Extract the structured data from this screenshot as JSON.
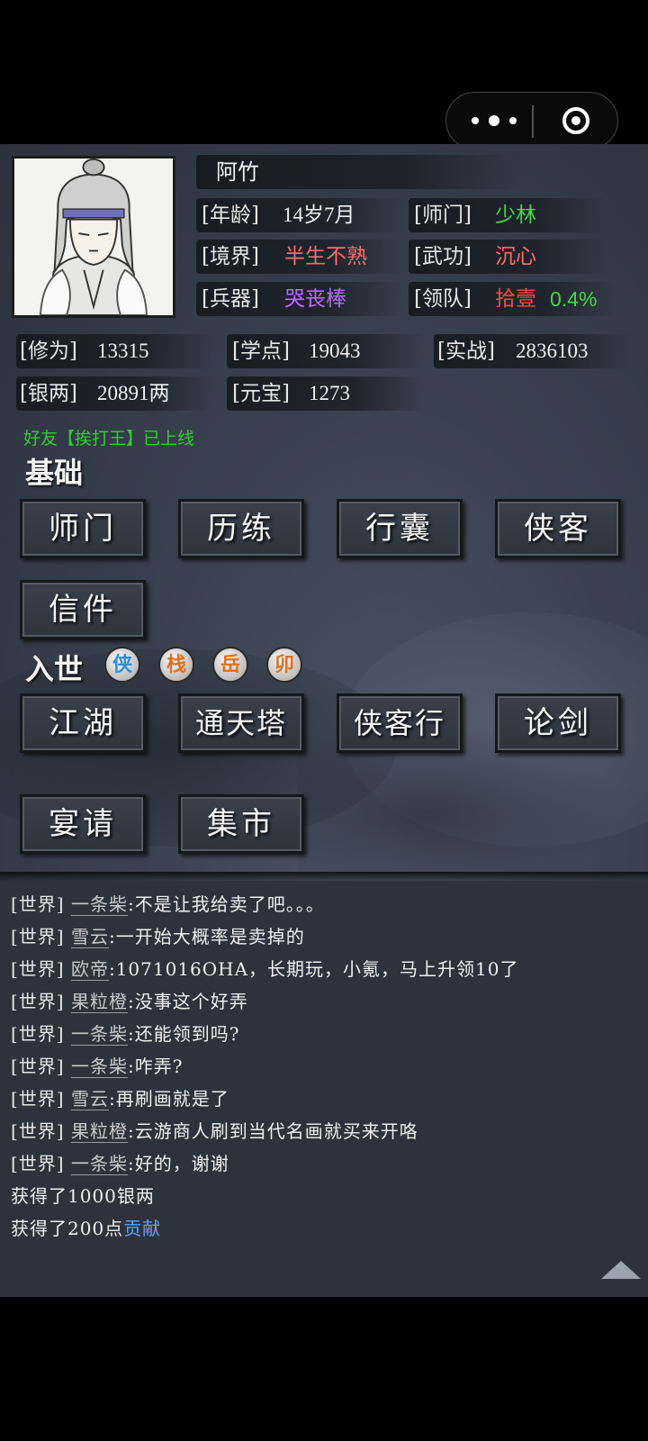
{
  "player": {
    "name": "阿竹",
    "age_label": "[年龄]",
    "age": "14岁7月",
    "sect_label": "[师门]",
    "sect": "少林",
    "realm_label": "[境界]",
    "realm": "半生不熟",
    "martial_label": "[武功]",
    "martial": "沉心",
    "weapon_label": "[兵器]",
    "weapon": "哭丧棒",
    "team_label": "[领队]",
    "team": "拾壹",
    "team_pct": "0.4%"
  },
  "stats": {
    "cultivation_label": "[修为]",
    "cultivation": "13315",
    "study_label": "[学点]",
    "study": "19043",
    "combat_label": "[实战]",
    "combat": "2836103",
    "silver_label": "[银两]",
    "silver": "20891两",
    "yuanbao_label": "[元宝]",
    "yuanbao": "1273"
  },
  "notice": "好友【挨打王】已上线",
  "basic": {
    "title": "基础",
    "buttons": [
      "师门",
      "历练",
      "行囊",
      "侠客",
      "信件"
    ]
  },
  "world": {
    "title": "入世",
    "badges": [
      {
        "label": "侠",
        "color": "#2f8fd8"
      },
      {
        "label": "栈",
        "color": "#e0701c"
      },
      {
        "label": "岳",
        "color": "#e0701c"
      },
      {
        "label": "卯",
        "color": "#e0701c"
      }
    ],
    "buttons": [
      "江湖",
      "通天塔",
      "侠客行",
      "论剑",
      "宴请",
      "集市"
    ]
  },
  "chat": [
    {
      "channel": "[世界]",
      "user": "一条柴",
      "text": ":不是让我给卖了吧。。。"
    },
    {
      "channel": "[世界]",
      "user": "雪云",
      "text": ":一开始大概率是卖掉的"
    },
    {
      "channel": "[世界]",
      "user": "欧帝",
      "text": ":1071016OHA，长期玩，小氪，马上升领10了"
    },
    {
      "channel": "[世界]",
      "user": "果粒橙",
      "text": ":没事这个好弄"
    },
    {
      "channel": "[世界]",
      "user": "一条柴",
      "text": ":还能领到吗?"
    },
    {
      "channel": "[世界]",
      "user": "一条柴",
      "text": ":咋弄?"
    },
    {
      "channel": "[世界]",
      "user": "雪云",
      "text": ":再刷画就是了"
    },
    {
      "channel": "[世界]",
      "user": "果粒橙",
      "text": ":云游商人刷到当代名画就买来开咯"
    },
    {
      "channel": "[世界]",
      "user": "一条柴",
      "text": ":好的，谢谢"
    }
  ],
  "system": {
    "line1": "获得了1000银两",
    "line2_text": "获得了200点",
    "line2_link": "贡献"
  }
}
